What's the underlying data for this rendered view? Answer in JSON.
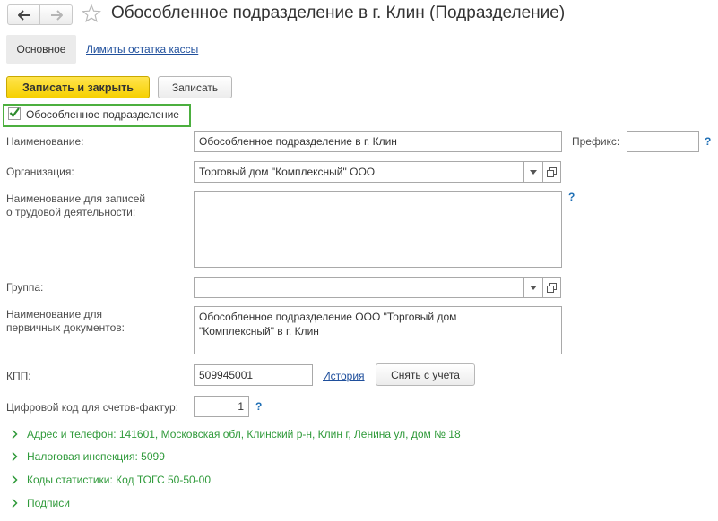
{
  "header": {
    "title": "Обособленное подразделение в г. Клин (Подразделение)"
  },
  "tabs": {
    "main": "Основное",
    "cash_limits": "Лимиты остатка кассы"
  },
  "toolbar": {
    "save_close": "Записать и закрыть",
    "save": "Записать"
  },
  "separate_unit": {
    "label": "Обособленное подразделение",
    "checked": true
  },
  "form": {
    "name_label": "Наименование:",
    "name_value": "Обособленное подразделение в г. Клин",
    "prefix_label": "Префикс:",
    "prefix_value": "",
    "help_mark": "?",
    "org_label": "Организация:",
    "org_value": "Торговый дом \"Комплексный\" ООО",
    "labor_name_label_line1": "Наименование для записей",
    "labor_name_label_line2": "о трудовой деятельности:",
    "labor_name_value": "",
    "group_label": "Группа:",
    "group_value": "",
    "primary_docs_label_line1": "Наименование для",
    "primary_docs_label_line2": "первичных документов:",
    "primary_docs_value_line1": "Обособленное подразделение ООО \"Торговый дом",
    "primary_docs_value_line2": "\"Комплексный\" в г. Клин",
    "kpp_label": "КПП:",
    "kpp_value": "509945001",
    "history_link": "История",
    "deregister_button": "Снять с учета",
    "invoice_code_label": "Цифровой код для счетов-фактур:",
    "invoice_code_value": "1"
  },
  "groups": [
    {
      "label": "Адрес и телефон: 141601, Московская обл, Клинский р-н, Клин г, Ленина ул, дом № 18"
    },
    {
      "label": "Налоговая инспекция: 5099"
    },
    {
      "label": "Коды статистики: Код ТОГС 50-50-00"
    },
    {
      "label": "Подписи"
    }
  ],
  "colors": {
    "accent_yellow": "#f6d000",
    "group_green": "#2f9a3a",
    "checkbox_frame": "#4caf3f",
    "link_blue": "#1f4f9c"
  },
  "icons": {
    "back": "arrow-left-icon",
    "forward": "arrow-right-icon",
    "favorite": "star-icon",
    "dropdown": "chevron-down-icon",
    "open": "open-window-icon",
    "expand": "chevron-right-icon"
  }
}
